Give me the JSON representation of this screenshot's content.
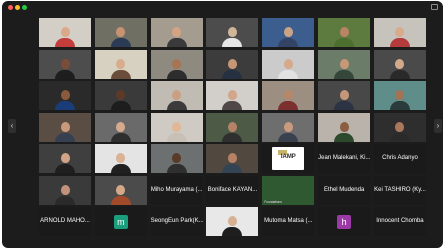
{
  "window": {
    "title": "",
    "colors": {
      "background": "#1c1c1c",
      "tile_background": "#2b2b2b",
      "name_text": "#ffffff",
      "active_speaker_border": "#f6c945"
    }
  },
  "navigation": {
    "prev_page_icon": "chevron-left-icon",
    "prev_page_glyph": "‹",
    "next_page_icon": "chevron-right-icon",
    "next_page_glyph": "›"
  },
  "participants": [
    {
      "kind": "video",
      "label": "",
      "bg": "#d3cfc6",
      "skin": "#d9a98a",
      "shirt": "#c43d3d"
    },
    {
      "kind": "video",
      "label": "",
      "bg": "#6f7063",
      "skin": "#c7926f",
      "shirt": "#2b3a55"
    },
    {
      "kind": "video",
      "label": "",
      "bg": "#a59c90",
      "skin": "#d4a384",
      "shirt": "#3a3a3a"
    },
    {
      "kind": "video",
      "label": "",
      "bg": "#4c4c4c",
      "skin": "#d1b59a",
      "shirt": "#e6e6e6"
    },
    {
      "kind": "video",
      "label": "",
      "bg": "#3b5e8f",
      "skin": "#caa387",
      "shirt": "#334466"
    },
    {
      "kind": "video",
      "label": "",
      "bg": "#5d7a3f",
      "skin": "#b98463",
      "shirt": "#4c6f2e"
    },
    {
      "kind": "video",
      "label": "",
      "bg": "#c6c3bd",
      "skin": "#d9aa8c",
      "shirt": "#b33b3b"
    },
    {
      "kind": "video",
      "label": "",
      "bg": "#4d4d4d",
      "skin": "#7a4e36",
      "shirt": "#1e1e1e"
    },
    {
      "kind": "video",
      "label": "",
      "bg": "#d7d1c2",
      "skin": "#d8ad8d",
      "shirt": "#6a4d3a"
    },
    {
      "kind": "video",
      "label": "",
      "bg": "#8f8a7f",
      "skin": "#a77454",
      "shirt": "#2d2d2d"
    },
    {
      "kind": "video",
      "label": "",
      "bg": "#3c3c3c",
      "skin": "#c79676",
      "shirt": "#253040"
    },
    {
      "kind": "video",
      "label": "",
      "bg": "#cbcbcb",
      "skin": "#d6a98a",
      "shirt": "#e2e2e2"
    },
    {
      "kind": "video",
      "label": "",
      "bg": "#6b7c69",
      "skin": "#c69877",
      "shirt": "#35463a"
    },
    {
      "kind": "video",
      "label": "",
      "bg": "#4a4a4a",
      "skin": "#d4a98b",
      "shirt": "#2a2a2a"
    },
    {
      "kind": "video",
      "label": "",
      "bg": "#2a2a2a",
      "skin": "#8a5a3c",
      "shirt": "#1a3d7a"
    },
    {
      "kind": "video",
      "label": "",
      "bg": "#3a3a3a",
      "skin": "#5c3a27",
      "shirt": "#1d1d1d"
    },
    {
      "kind": "video",
      "label": "",
      "bg": "#c0bcb4",
      "skin": "#caa084",
      "shirt": "#3b3b3b"
    },
    {
      "kind": "video",
      "label": "",
      "bg": "#d2cfca",
      "skin": "#d2a68a",
      "shirt": "#504848"
    },
    {
      "kind": "video",
      "label": "",
      "bg": "#9c8f82",
      "skin": "#b6876b",
      "shirt": "#7b2f2f"
    },
    {
      "kind": "video",
      "label": "",
      "bg": "#484848",
      "skin": "#c4967a",
      "shirt": "#2c3344"
    },
    {
      "kind": "video",
      "label": "",
      "bg": "#5e8d8a",
      "skin": "#a47356",
      "shirt": "#2b3a3a"
    },
    {
      "kind": "video",
      "label": "",
      "bg": "#5a4d43",
      "skin": "#c9997c",
      "shirt": "#364050"
    },
    {
      "kind": "video",
      "label": "",
      "bg": "#6a6a6a",
      "skin": "#d5aa8d",
      "shirt": "#2e2e2e"
    },
    {
      "kind": "video",
      "label": "",
      "bg": "#cfcac3",
      "skin": "#e0b898",
      "shirt": "#c7c0b5"
    },
    {
      "kind": "video",
      "label": "",
      "bg": "#4d5a45",
      "skin": "#b48266",
      "shirt": "#2f2f2f"
    },
    {
      "kind": "video",
      "label": "",
      "bg": "#6e6e6e",
      "skin": "#c89a7f",
      "shirt": "#39414f"
    },
    {
      "kind": "video",
      "label": "",
      "bg": "#b9b3ab",
      "skin": "#8b5e42",
      "shirt": "#2d4a2d"
    },
    {
      "kind": "video",
      "label": "",
      "bg": "#2e2e2e",
      "skin": "#a9785b",
      "shirt": "#2a2a2a"
    },
    {
      "kind": "video",
      "label": "",
      "bg": "#3f3f3f",
      "skin": "#d1a487",
      "shirt": "#1f1f1f"
    },
    {
      "kind": "video",
      "label": "",
      "bg": "#e4e4e4",
      "skin": "#d9b193",
      "shirt": "#202020"
    },
    {
      "kind": "video",
      "label": "",
      "bg": "#6c7070",
      "skin": "#5a3a28",
      "shirt": "#2f2f2f"
    },
    {
      "kind": "video",
      "label": "",
      "bg": "#51493f",
      "skin": "#b68164",
      "shirt": "#334455"
    },
    {
      "kind": "logo",
      "label": "",
      "logo_text": "IAMP",
      "bg": "#c8b36a"
    },
    {
      "kind": "name",
      "name": "Jean Malekani, Ki..."
    },
    {
      "kind": "name",
      "name": "Chris Adanyo"
    },
    {
      "kind": "video",
      "label": "",
      "bg": "#3a3a3a",
      "skin": "#c2927a",
      "shirt": "#2a2a2a"
    },
    {
      "kind": "video",
      "label": "",
      "bg": "#4b4b4b",
      "skin": "#d5a88a",
      "shirt": "#a34a2a"
    },
    {
      "kind": "name",
      "name": "Miho Murayama (..."
    },
    {
      "kind": "name",
      "name": "Boniface KAYAN..."
    },
    {
      "kind": "video",
      "label": "Foundations",
      "bg": "#2f5a31",
      "skin": "#2f5a31",
      "shirt": "#2f5a31"
    },
    {
      "kind": "name",
      "name": "Ethel Mudenda"
    },
    {
      "kind": "name",
      "name": "Kei TASHIRO (Ky..."
    },
    {
      "kind": "name",
      "name": "ARNOLD MAHO..."
    },
    {
      "kind": "avatar",
      "letter": "m",
      "color": "#1b9e7e"
    },
    {
      "kind": "name",
      "name": "SeongEun Park(K..."
    },
    {
      "kind": "video",
      "label": "",
      "bg": "#e8e8e8",
      "skin": "#d8b094",
      "shirt": "#1e1e1e"
    },
    {
      "kind": "name",
      "name": "Mutoma Matsa (..."
    },
    {
      "kind": "avatar",
      "letter": "h",
      "color": "#9b3aa6"
    },
    {
      "kind": "name",
      "name": "Innocent Chomba"
    }
  ]
}
